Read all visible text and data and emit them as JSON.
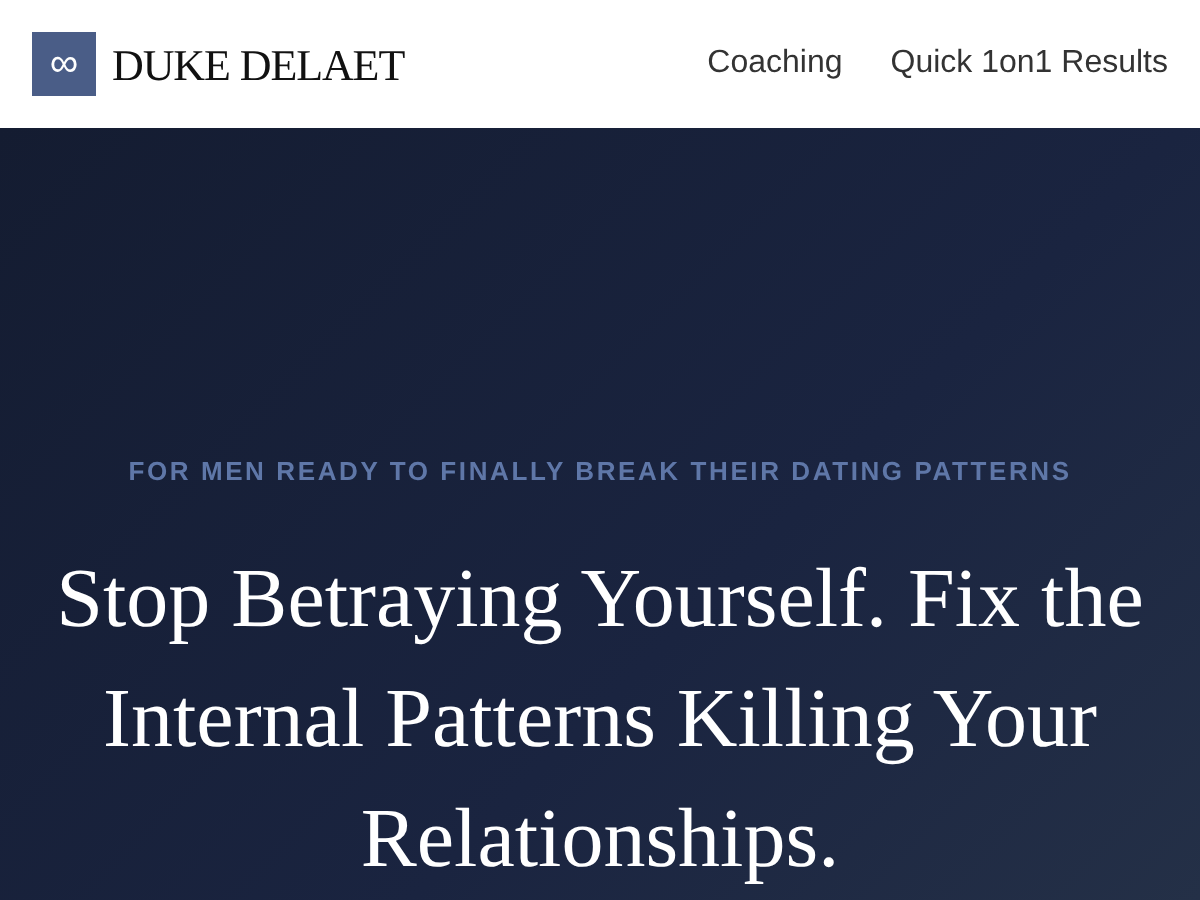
{
  "header": {
    "logo_mark": "∞",
    "brand": "DUKE DELAET",
    "nav": [
      {
        "label": "Coaching"
      },
      {
        "label": "Quick 1on1 Results"
      }
    ]
  },
  "hero": {
    "eyebrow": "FOR MEN READY TO FINALLY BREAK THEIR DATING PATTERNS",
    "headline": "Stop Betraying Yourself. Fix the Internal Patterns Killing Your Relationships."
  }
}
